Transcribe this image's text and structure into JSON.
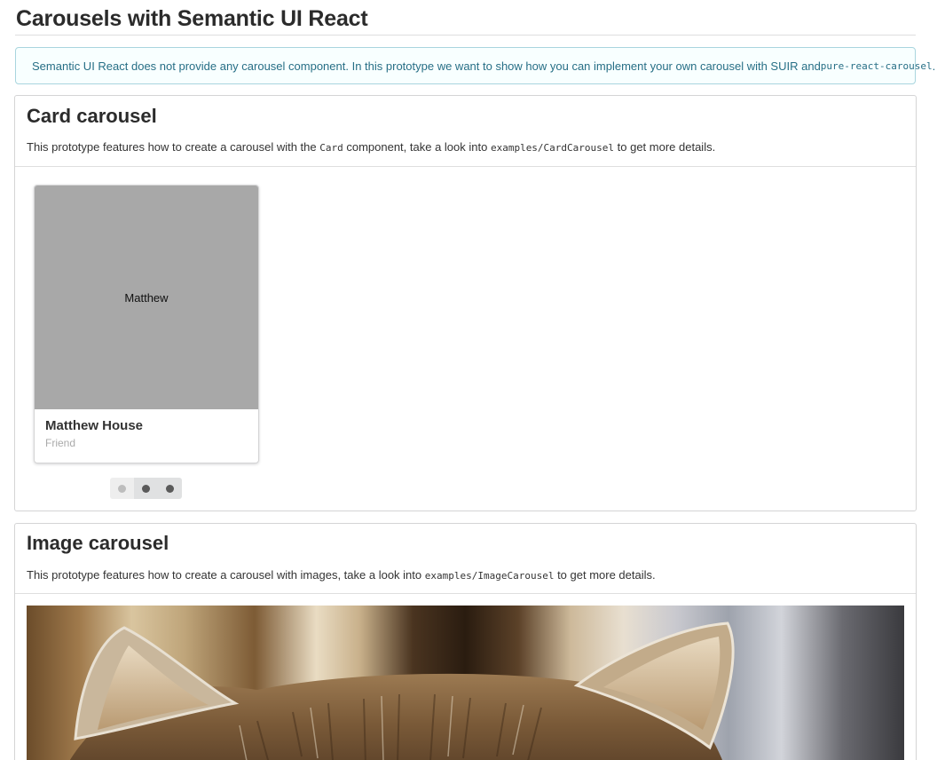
{
  "page": {
    "title": "Carousels with Semantic UI React"
  },
  "info": {
    "text": "Semantic UI React does not provide any carousel component. In this prototype we want to show how you can implement your own carousel with SUIR and ",
    "code": "pure-react-carousel",
    "suffix": "."
  },
  "card_carousel": {
    "title": "Card carousel",
    "desc_prefix": "This prototype features how to create a carousel with the ",
    "desc_code1": "Card",
    "desc_middle": " component, take a look into ",
    "desc_code2": "examples/CardCarousel",
    "desc_suffix": " to get more details.",
    "card": {
      "image_text": "Matthew",
      "header": "Matthew House",
      "meta": "Friend"
    },
    "dots": [
      {
        "active": true
      },
      {
        "active": false
      },
      {
        "active": false
      }
    ]
  },
  "image_carousel": {
    "title": "Image carousel",
    "desc_prefix": "This prototype features how to create a carousel with images, take a look into ",
    "desc_code": "examples/ImageCarousel",
    "desc_suffix": " to get more details."
  },
  "colors": {
    "info_bg": "#f8ffff",
    "info_border": "#a9d5de",
    "info_text": "#276f86",
    "card_image_bg": "#a8a8a8"
  }
}
